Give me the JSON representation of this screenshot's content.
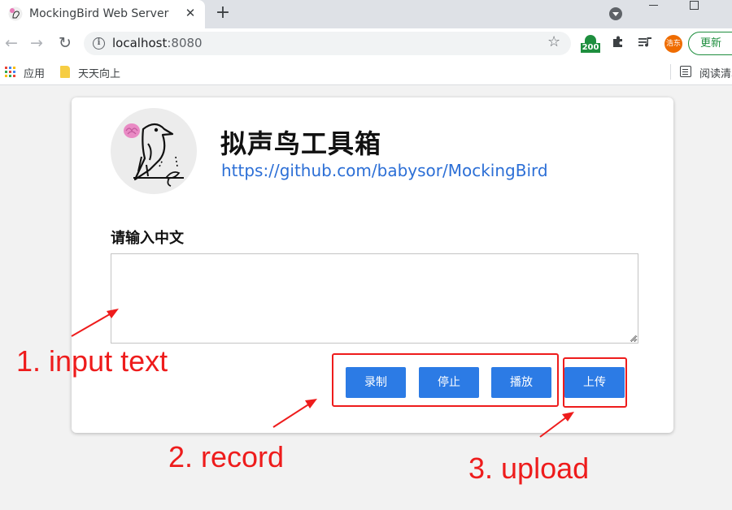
{
  "browser": {
    "tab_title": "MockingBird Web Server",
    "url_host": "localhost",
    "url_port": ":8080",
    "extension_badge": "200",
    "profile_name": "浩东",
    "update_label": "更新",
    "bookmarks": [
      {
        "label": "应用",
        "icon": "apps-grid-icon"
      },
      {
        "label": "天天向上",
        "icon": "folder-icon"
      }
    ],
    "reading_list_label": "阅读清单"
  },
  "page": {
    "title": "拟声鸟工具箱",
    "link": "https://github.com/babysor/MockingBird",
    "input_label": "请输入中文",
    "buttons": {
      "record": "录制",
      "stop": "停止",
      "play": "播放",
      "upload": "上传"
    }
  },
  "annotations": {
    "step1": "1. input text",
    "step2": "2. record",
    "step3": "3. upload"
  },
  "colors": {
    "button": "#2c7be5",
    "link": "#2c6fd6",
    "annotation": "#ee1c1c",
    "update_green": "#1e8e3e"
  }
}
